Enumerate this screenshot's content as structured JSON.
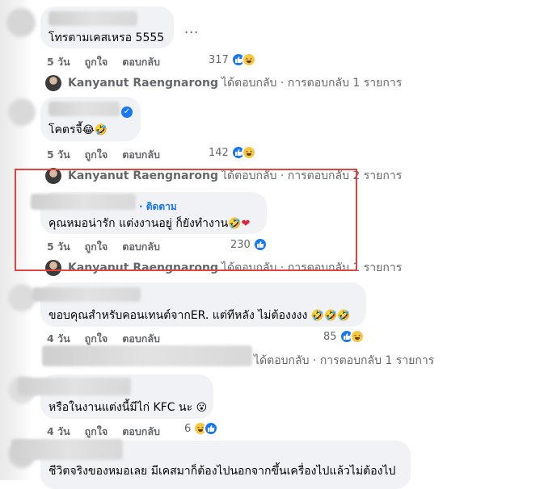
{
  "comments": [
    {
      "text": "โทรตามเคสเหรอ 5555",
      "time": "5 วัน",
      "like_label": "ถูกใจ",
      "reply_label": "ตอบกลับ",
      "reaction_count": "317",
      "more_label": "...",
      "reactions": [
        "like-icon",
        "haha-icon"
      ]
    },
    {
      "text": "โคตรจี้",
      "time": "5 วัน",
      "like_label": "ถูกใจ",
      "reply_label": "ตอบกลับ",
      "reaction_count": "142",
      "reactions": [
        "like-icon",
        "haha-icon"
      ]
    },
    {
      "text": "คุณหมอน่ารัก แต่งงานอยู่ ก็ยังทำงาน",
      "follow_label": "· ติดตาม",
      "time": "5 วัน",
      "like_label": "ถูกใจ",
      "reply_label": "ตอบกลับ",
      "reaction_count": "230",
      "reactions": [
        "like-icon"
      ]
    },
    {
      "text": "ขอบคุณสำหรับคอนเทนต์จากER. แต่ทีหลัง ไม่ต้องงงง",
      "time": "4 วัน",
      "like_label": "ถูกใจ",
      "reply_label": "ตอบกลับ",
      "reaction_count": "85",
      "reactions": [
        "like-icon",
        "haha-icon"
      ]
    },
    {
      "text": "หรือในงานแต่งนี้มีไก่ KFC นะ",
      "time": "4 วัน",
      "like_label": "ถูกใจ",
      "reply_label": "ตอบกลับ",
      "reaction_count": "6",
      "reactions": [
        "haha-icon",
        "like-icon"
      ]
    },
    {
      "text": "ชีวิตจริงของหมอเลย มีเคสมาก็ต้องไปนอกจากขึ้นเครื่องไปแล้วไม่ต้องไป"
    }
  ],
  "replies": [
    {
      "name": "Kanyanut Raengnarong",
      "text": "ได้ตอบกลับ · การตอบกลับ 1 รายการ"
    },
    {
      "name": "Kanyanut Raengnarong",
      "text": "ได้ตอบกลับ · การตอบกลับ 2 รายการ"
    },
    {
      "name": "Kanyanut Raengnarong",
      "text": "ได้ตอบกลับ · การตอบกลับ 1 รายการ"
    },
    {
      "name": "",
      "text": "ได้ตอบกลับ · การตอบกลับ 1 รายการ"
    }
  ],
  "colors": {
    "link_blue": "#1877f2",
    "bubble_bg": "#f0f2f5",
    "highlight_red": "#e0443e"
  }
}
